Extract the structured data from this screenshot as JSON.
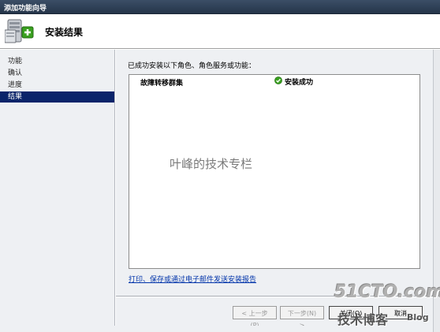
{
  "window": {
    "title": "添加功能向导"
  },
  "header": {
    "title": "安装结果",
    "icon": "server-add-icon"
  },
  "sidebar": {
    "items": [
      {
        "label": "功能",
        "active": false
      },
      {
        "label": "确认",
        "active": false
      },
      {
        "label": "进度",
        "active": false
      },
      {
        "label": "结果",
        "active": true
      }
    ]
  },
  "main": {
    "intro": "已成功安装以下角色、角色服务或功能：",
    "results": [
      {
        "feature": "故障转移群集",
        "status": "安装成功",
        "status_icon": "success-check-icon"
      }
    ],
    "report_link": "打印、保存或通过电子邮件发送安装报告"
  },
  "buttons": {
    "prev": "< 上一步(P)",
    "next": "下一步(N) >",
    "close": "关闭(O)",
    "cancel": "取消"
  },
  "watermark": "叶峰的技术专栏",
  "logo": {
    "main": "51CTO.com",
    "sub": "技术博客",
    "suffix": "Blog"
  },
  "colors": {
    "titlebar": "#25354a",
    "selected": "#0a246a",
    "link": "#0033aa",
    "success": "#3aa020"
  }
}
